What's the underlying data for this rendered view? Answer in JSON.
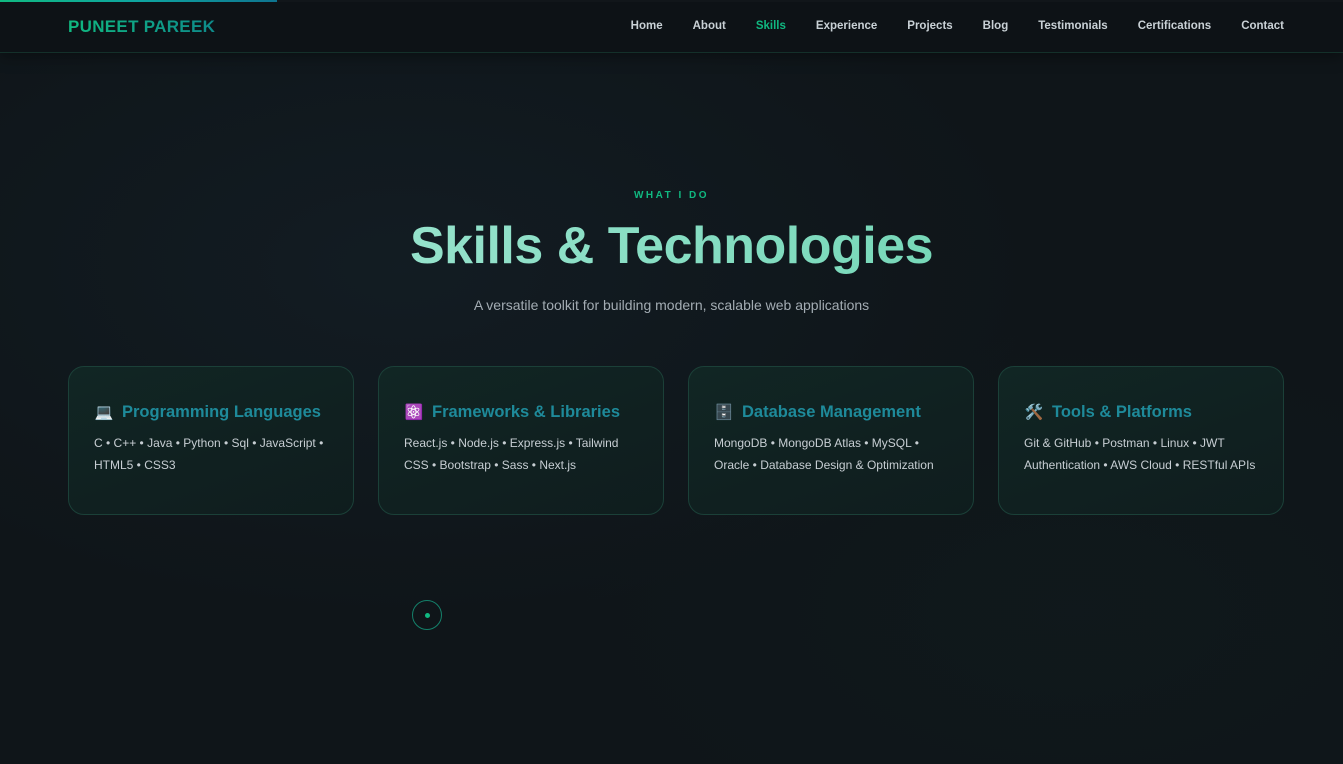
{
  "scroll_progress": 0.206,
  "brand": {
    "name": "PUNEET PAREEK"
  },
  "nav": {
    "items": [
      {
        "label": "Home"
      },
      {
        "label": "About"
      },
      {
        "label": "Skills"
      },
      {
        "label": "Experience"
      },
      {
        "label": "Projects"
      },
      {
        "label": "Blog"
      },
      {
        "label": "Testimonials"
      },
      {
        "label": "Certifications"
      },
      {
        "label": "Contact"
      }
    ],
    "active": "Skills"
  },
  "skills": {
    "eyebrow": "WHAT I DO",
    "title": "Skills & Technologies",
    "subtitle": "A versatile toolkit for building modern, scalable web applications",
    "cards": [
      {
        "icon": "laptop-icon",
        "icon_glyph": "💻",
        "title": "Programming Languages",
        "text": "C • C++ • Java • Python • Sql • JavaScript • HTML5 • CSS3"
      },
      {
        "icon": "atom-icon",
        "icon_glyph": "⚛️",
        "title": "Frameworks & Libraries",
        "text": "React.js • Node.js • Express.js • Tailwind CSS • Bootstrap • Sass • Next.js"
      },
      {
        "icon": "database-icon",
        "icon_glyph": "🗄️",
        "title": "Database Management",
        "text": "MongoDB • MongoDB Atlas • MySQL • Oracle • Database Design & Optimization"
      },
      {
        "icon": "tools-icon",
        "icon_glyph": "🛠️",
        "title": "Tools & Platforms",
        "text": "Git & GitHub • Postman • Linux • JWT Authentication • AWS Cloud • RESTful APIs"
      }
    ]
  },
  "colors": {
    "accent": "#10b981",
    "card_title": "#1e8a9a",
    "background": "#0f1519"
  }
}
